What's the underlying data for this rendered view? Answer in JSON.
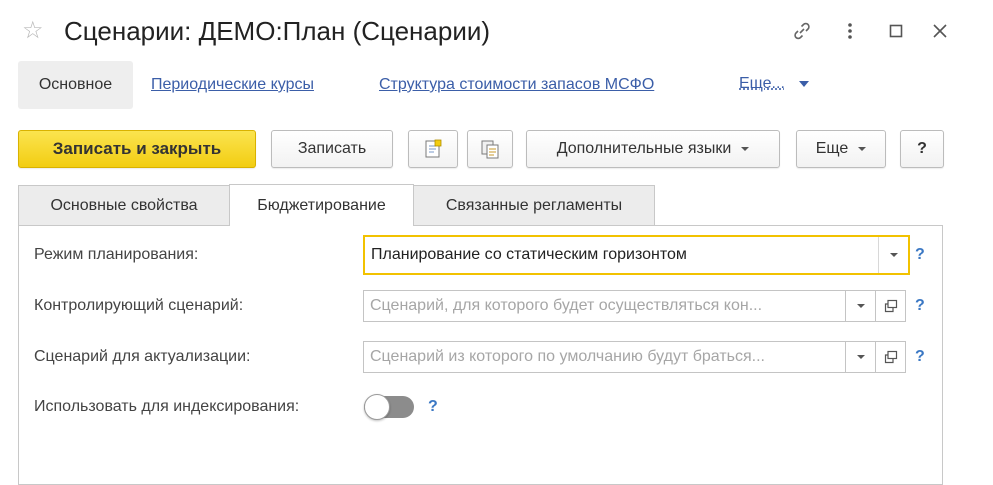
{
  "window": {
    "title": "Сценарии: ДЕМО:План (Сценарии)",
    "icons": [
      "star-icon",
      "link-icon",
      "more-vertical-icon",
      "maximize-icon",
      "close-icon"
    ]
  },
  "nav": {
    "active": "Основное",
    "links": [
      "Периодические курсы",
      "Структура стоимости запасов МСФО"
    ],
    "more": "Еще..."
  },
  "toolbar": {
    "save_close": "Записать и закрыть",
    "save": "Записать",
    "languages": "Дополнительные языки",
    "more": "Еще",
    "help": "?"
  },
  "tabs": [
    "Основные свойства",
    "Бюджетирование",
    "Связанные регламенты"
  ],
  "active_tab": "Бюджетирование",
  "form": {
    "planning_mode": {
      "label": "Режим планирования:",
      "value": "Планирование со статическим горизонтом"
    },
    "controlling_scenario": {
      "label": "Контролирующий сценарий:",
      "placeholder": "Сценарий, для которого будет осуществляться кон..."
    },
    "actualization_scenario": {
      "label": "Сценарий для актуализации:",
      "placeholder": "Сценарий из которого по умолчанию будут браться..."
    },
    "use_for_indexing": {
      "label": "Использовать для индексирования:",
      "value": false
    },
    "help_mark": "?"
  },
  "colors": {
    "accent_yellow": "#f2cd12",
    "link_blue": "#3b5ea8",
    "focus_border": "#f2c200",
    "help_blue": "#3b78c4"
  }
}
